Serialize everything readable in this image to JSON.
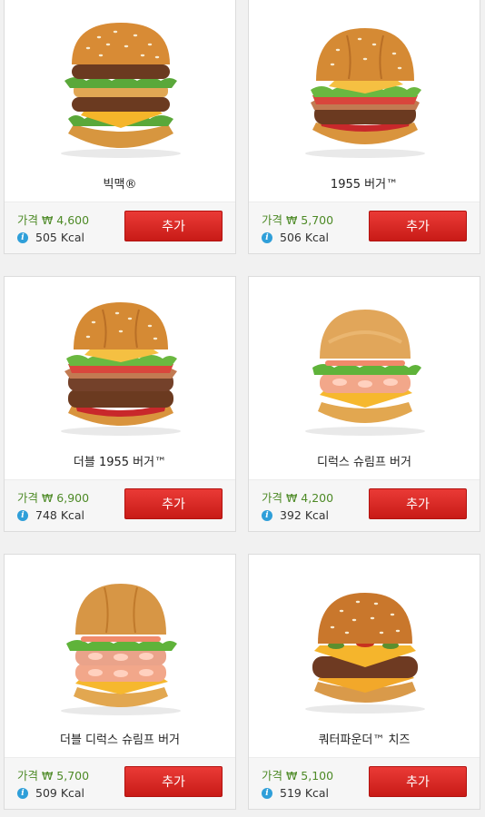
{
  "products": [
    {
      "name": "빅맥®",
      "price": "가격 ₩ 4,600",
      "kcal": "505 Kcal",
      "add_label": "추가",
      "image": "big-mac-burger"
    },
    {
      "name": "1955 버거™",
      "price": "가격 ₩ 5,700",
      "kcal": "506 Kcal",
      "add_label": "추가",
      "image": "1955-burger"
    },
    {
      "name": "더블 1955 버거™",
      "price": "가격 ₩ 6,900",
      "kcal": "748 Kcal",
      "add_label": "추가",
      "image": "double-1955-burger"
    },
    {
      "name": "디럭스 슈림프 버거",
      "price": "가격 ₩ 4,200",
      "kcal": "392 Kcal",
      "add_label": "추가",
      "image": "deluxe-shrimp-burger"
    },
    {
      "name": "더블 디럭스 슈림프 버거",
      "price": "가격 ₩ 5,700",
      "kcal": "509 Kcal",
      "add_label": "추가",
      "image": "double-deluxe-shrimp-burger"
    },
    {
      "name": "쿼터파운더™ 치즈",
      "price": "가격 ₩ 5,100",
      "kcal": "519 Kcal",
      "add_label": "추가",
      "image": "quarter-pounder-cheese-burger"
    }
  ],
  "colors": {
    "accent": "#d8231f",
    "price": "#4d8a26",
    "info": "#2f9fd9"
  }
}
